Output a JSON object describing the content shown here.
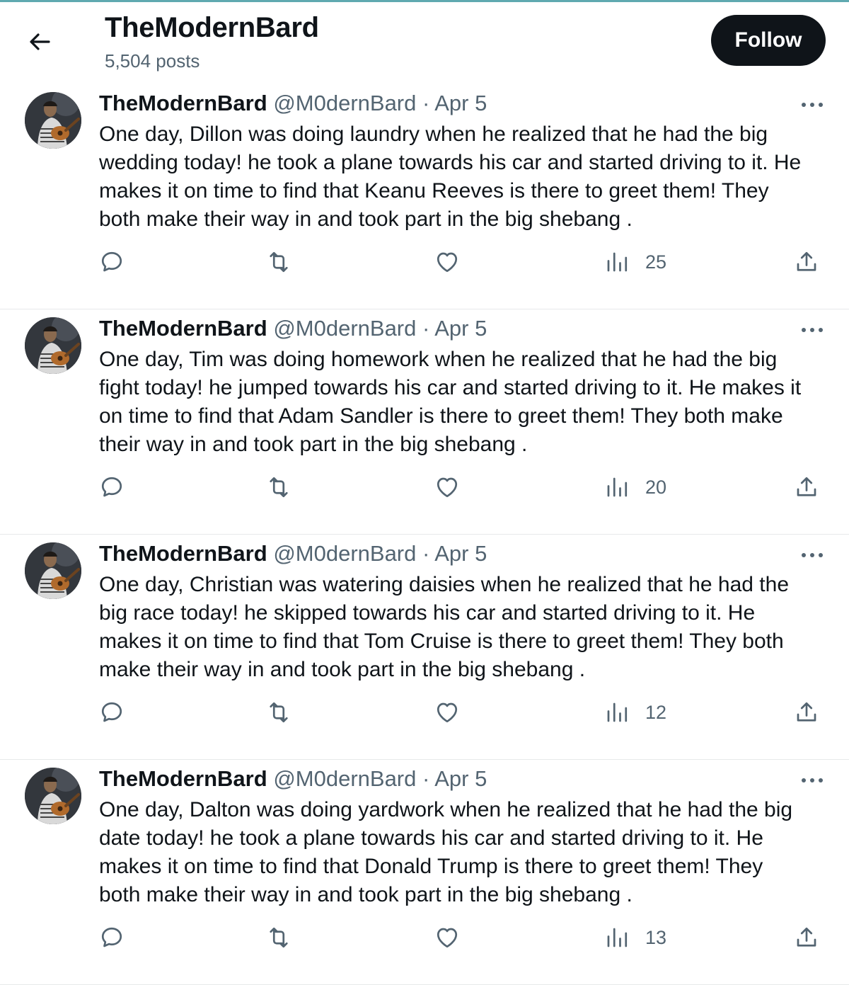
{
  "header": {
    "title": "TheModernBard",
    "posts_count": "5,504 posts",
    "follow_label": "Follow"
  },
  "tweets": [
    {
      "name": "TheModernBard",
      "handle": "@M0dernBard",
      "dot": "·",
      "date": "Apr 5",
      "lines": [
        "One day, Dillon was doing laundry when he realized that he had the big",
        "wedding today! he took a plane towards his car and started driving to it. He",
        "makes it on time to find that Keanu Reeves is there to greet them! They",
        "both make their way in and took part in the big shebang ."
      ],
      "views": "25"
    },
    {
      "name": "TheModernBard",
      "handle": "@M0dernBard",
      "dot": "·",
      "date": "Apr 5",
      "lines": [
        "One day, Tim was doing homework when he realized that he had the big",
        "fight today! he jumped towards his car and started driving to it. He makes it",
        "on time to find that Adam Sandler is there to greet them! They  both make",
        "their way in and took part in the big shebang ."
      ],
      "views": "20"
    },
    {
      "name": "TheModernBard",
      "handle": "@M0dernBard",
      "dot": "·",
      "date": "Apr 5",
      "lines": [
        "One day, Christian was watering daisies when he realized that he had the",
        "big race today! he skipped towards his car and started driving to it. He",
        "makes it on time to find that Tom Cruise is there to greet them! They  both",
        "make their way in and took part in the big shebang ."
      ],
      "views": "12"
    },
    {
      "name": "TheModernBard",
      "handle": "@M0dernBard",
      "dot": "·",
      "date": "Apr 5",
      "lines": [
        "One day, Dalton was doing yardwork when he realized that he had the big",
        "date today! he took a plane towards his car and started driving to it. He",
        "makes it on time to find that Donald Trump is there to greet them! They",
        "both make their way in and took part in the big shebang ."
      ],
      "views": "13"
    }
  ],
  "icons": {
    "back": "arrow-left-icon",
    "more": "more-dots-icon",
    "reply": "reply-icon",
    "retweet": "retweet-icon",
    "like": "heart-icon",
    "views": "views-chart-icon",
    "share": "share-icon"
  },
  "colors": {
    "text": "#0f1419",
    "secondary": "#536471",
    "divider": "#e7e9ea",
    "button_bg": "#0f1419",
    "top_accent": "#5fa9b0"
  }
}
